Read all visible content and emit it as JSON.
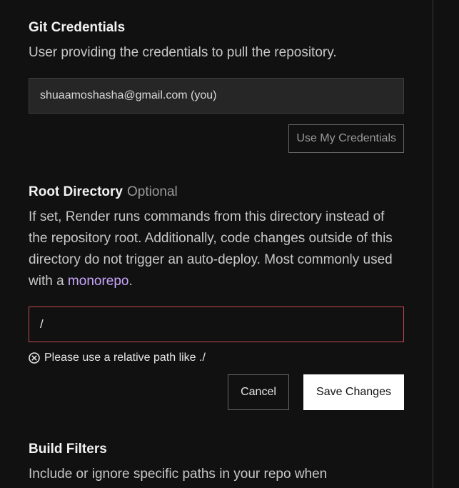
{
  "git_credentials": {
    "title": "Git Credentials",
    "description": "User providing the credentials to pull the repository.",
    "value": "shuaamoshasha@gmail.com (you)",
    "use_my_credentials_label": "Use My Credentials"
  },
  "root_directory": {
    "title": "Root Directory",
    "optional_label": "Optional",
    "description_prefix": "If set, Render runs commands from this directory instead of the repository root. Additionally, code changes outside of this directory do not trigger an auto-deploy. Most commonly used with a ",
    "description_link": "monorepo",
    "description_suffix": ".",
    "input_value": "/",
    "error_message": "Please use a relative path like ./",
    "cancel_label": "Cancel",
    "save_label": "Save Changes"
  },
  "build_filters": {
    "title": "Build Filters",
    "description": "Include or ignore specific paths in your repo when"
  },
  "colors": {
    "background": "#111111",
    "error_border": "#c24b55",
    "link": "#c9a6ff",
    "primary_button": "#ffffff"
  },
  "icons": {
    "error": "x-circle-icon"
  }
}
